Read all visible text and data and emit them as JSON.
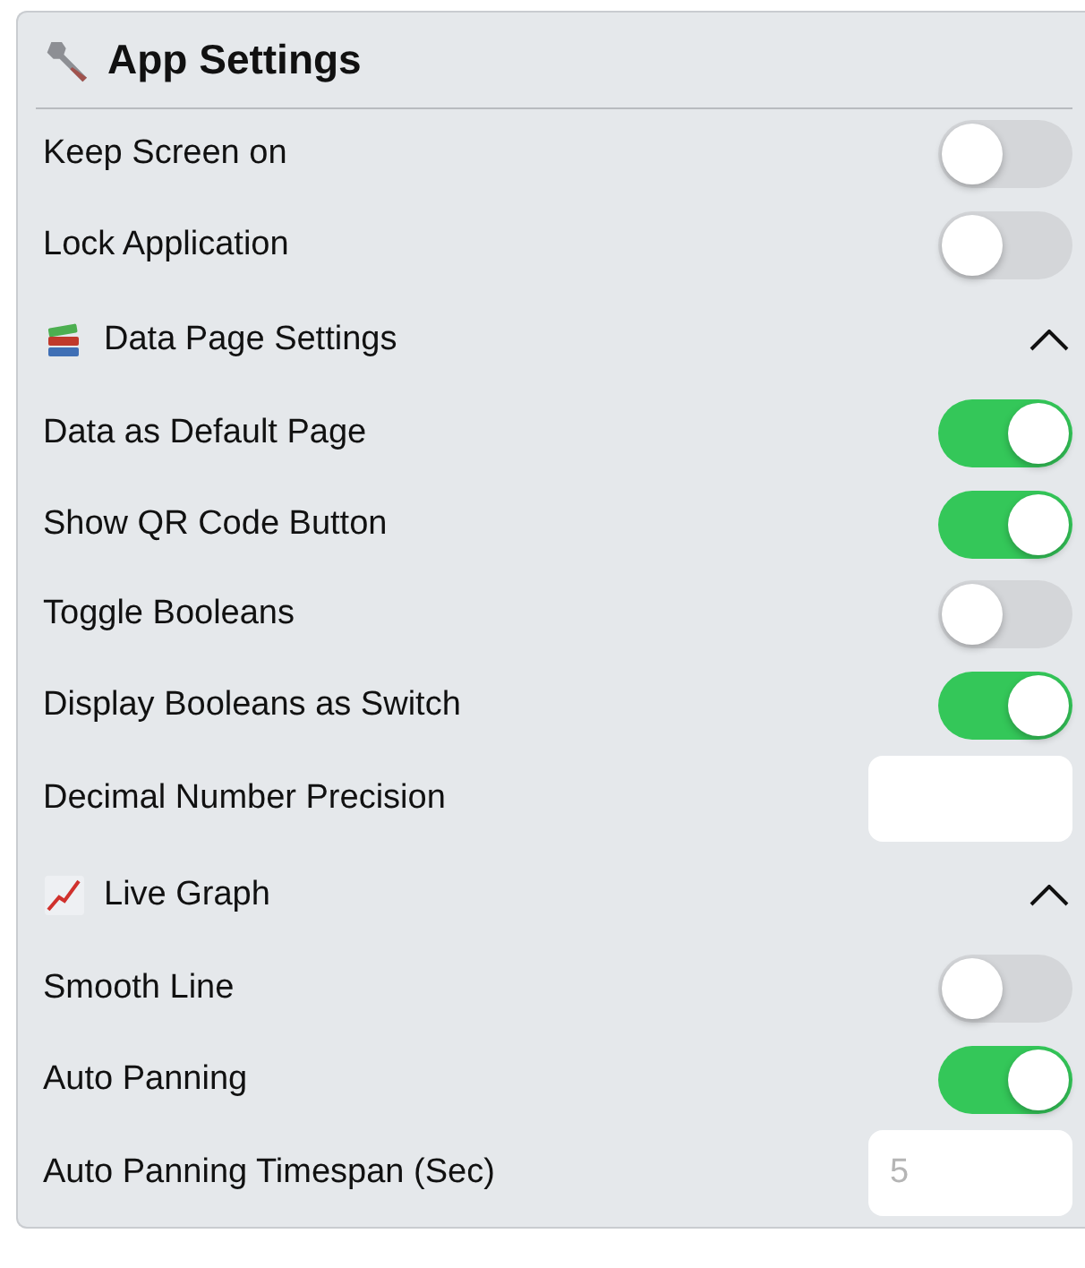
{
  "panel": {
    "title": "App Settings"
  },
  "items": [
    {
      "kind": "toggle",
      "label": "Keep Screen on",
      "on": false
    },
    {
      "kind": "toggle",
      "label": "Lock Application",
      "on": false
    },
    {
      "kind": "section",
      "label": "Data Page Settings",
      "expanded": true
    },
    {
      "kind": "toggle",
      "label": "Data as Default Page",
      "on": true
    },
    {
      "kind": "toggle",
      "label": "Show QR Code Button",
      "on": true
    },
    {
      "kind": "toggle",
      "label": "Toggle Booleans",
      "on": false
    },
    {
      "kind": "toggle",
      "label": "Display Booleans as Switch",
      "on": true
    },
    {
      "kind": "number",
      "label": "Decimal Number Precision"
    },
    {
      "kind": "section",
      "label": "Live Graph",
      "expanded": true
    },
    {
      "kind": "toggle",
      "label": "Smooth Line",
      "on": false
    },
    {
      "kind": "toggle",
      "label": "Auto Panning",
      "on": true
    },
    {
      "kind": "number",
      "label": "Auto Panning Timespan (Sec)",
      "placeholder": "5"
    }
  ]
}
